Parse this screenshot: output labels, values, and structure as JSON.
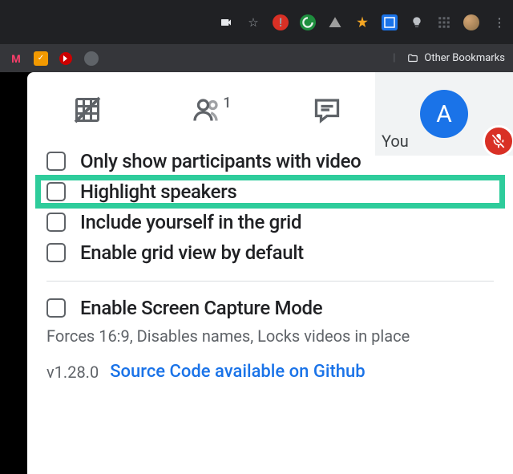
{
  "bookmarks": {
    "other": "Other Bookmarks"
  },
  "selfTile": {
    "label": "You",
    "initial": "A"
  },
  "tabs": {
    "peopleCount": "1"
  },
  "options": {
    "items": [
      {
        "label": "Only show participants with video"
      },
      {
        "label": "Highlight speakers"
      },
      {
        "label": "Include yourself in the grid"
      },
      {
        "label": "Enable grid view by default"
      }
    ],
    "capture": {
      "label": "Enable Screen Capture Mode",
      "desc": "Forces 16:9, Disables names, Locks videos in place"
    }
  },
  "footer": {
    "version": "v1.28.0",
    "sourceLink": "Source Code available on Github"
  }
}
